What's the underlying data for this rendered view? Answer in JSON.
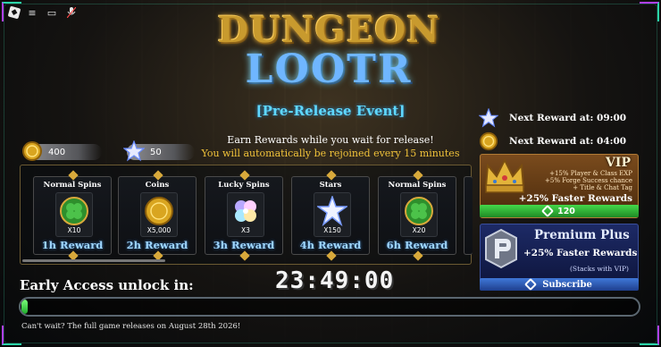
{
  "topbar": {
    "icons": [
      "roblox-logo-icon",
      "menu-icon",
      "chat-icon",
      "mic-muted-icon"
    ],
    "logo_glyph": "◆",
    "menu_glyph": "≡",
    "chat_glyph": "▭",
    "mic_glyph": "✕"
  },
  "logo": {
    "line1": "DUNGEON",
    "line2": "LOOTR"
  },
  "event": {
    "title": "[Pre-Release Event]",
    "subtitle": "Earn Rewards while you wait for release!",
    "rejoin": "You will automatically be rejoined every 15 minutes"
  },
  "currencies": {
    "coins": "400",
    "stars": "50"
  },
  "rewards": [
    {
      "title": "Normal Spins",
      "qty": "X10",
      "time": "1h Reward",
      "icon": "clover-icon"
    },
    {
      "title": "Coins",
      "qty": "X5,000",
      "time": "2h Reward",
      "icon": "coin-icon"
    },
    {
      "title": "Lucky Spins",
      "qty": "X3",
      "time": "3h Reward",
      "icon": "lucky-clover-icon"
    },
    {
      "title": "Stars",
      "qty": "X150",
      "time": "4h Reward",
      "icon": "star-icon"
    },
    {
      "title": "Normal Spins",
      "qty": "X20",
      "time": "6h Reward",
      "icon": "clover-icon"
    }
  ],
  "next_rewards": [
    {
      "label": "Next Reward at: 09:00",
      "icon": "star-icon"
    },
    {
      "label": "Next Reward at: 04:00",
      "icon": "coin-icon"
    }
  ],
  "vip": {
    "tag": "VIP",
    "perks": [
      "+15% Player & Class EXP",
      "+5% Forge Success chance",
      "+ Title & Chat Tag"
    ],
    "faster": "+25% Faster Rewards",
    "price": "120"
  },
  "premium": {
    "title": "Premium Plus",
    "faster": "+25% Faster Rewards",
    "note": "(Stacks with VIP)",
    "button": "Subscribe"
  },
  "unlock": {
    "label": "Early Access unlock in:",
    "timer": "23:49:00",
    "progress": 0.01
  },
  "footer": "Can't wait? The full game releases on August 28th 2026!",
  "colors": {
    "accent_cyan": "#5fd8ff",
    "gold": "#f0c23a",
    "green": "#1faa2c",
    "vip_brown": "#7a4b1d",
    "premium_blue": "#1d2a66"
  }
}
